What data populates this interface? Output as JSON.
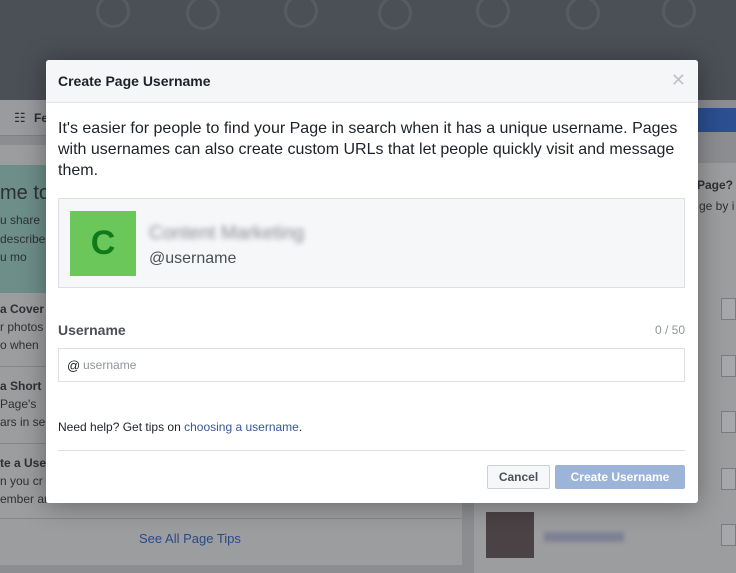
{
  "background": {
    "toolbar_label": "Fe",
    "left_card": {
      "heading": "me to",
      "green_lines": [
        "u share",
        "describe",
        "u mo"
      ],
      "tips": [
        {
          "title": "a Cover",
          "lines": [
            "r photos",
            "o when"
          ]
        },
        {
          "title": "a Short",
          "lines": [
            "Page's",
            "ars in se"
          ]
        },
        {
          "title": "te a Use",
          "lines": [
            "n you cr",
            "ember ar"
          ]
        }
      ],
      "see_all_link": "See All Page Tips"
    },
    "right_card": {
      "heading": "Page?",
      "line": "ge by i"
    }
  },
  "modal": {
    "title": "Create Page Username",
    "close_icon": "close-x-icon",
    "intro": "It's easier for people to find your Page in search when it has a unique username. Pages with usernames can also create custom URLs that let people quickly visit and message them.",
    "preview": {
      "avatar_letter": "C",
      "page_name": "Content Marketing",
      "username": "@username"
    },
    "field": {
      "label": "Username",
      "counter": "0 / 50",
      "prefix": "@",
      "placeholder": "username",
      "value": ""
    },
    "help": {
      "text": "Need help? Get tips on ",
      "link": "choosing a username",
      "suffix": "."
    },
    "buttons": {
      "cancel": "Cancel",
      "create": "Create Username"
    }
  },
  "colors": {
    "brand_blue": "#4267b2",
    "link": "#365899",
    "avatar_green": "#6cc75b",
    "avatar_letter": "#0e7a1a",
    "disabled_button": "#9cb4d8"
  }
}
